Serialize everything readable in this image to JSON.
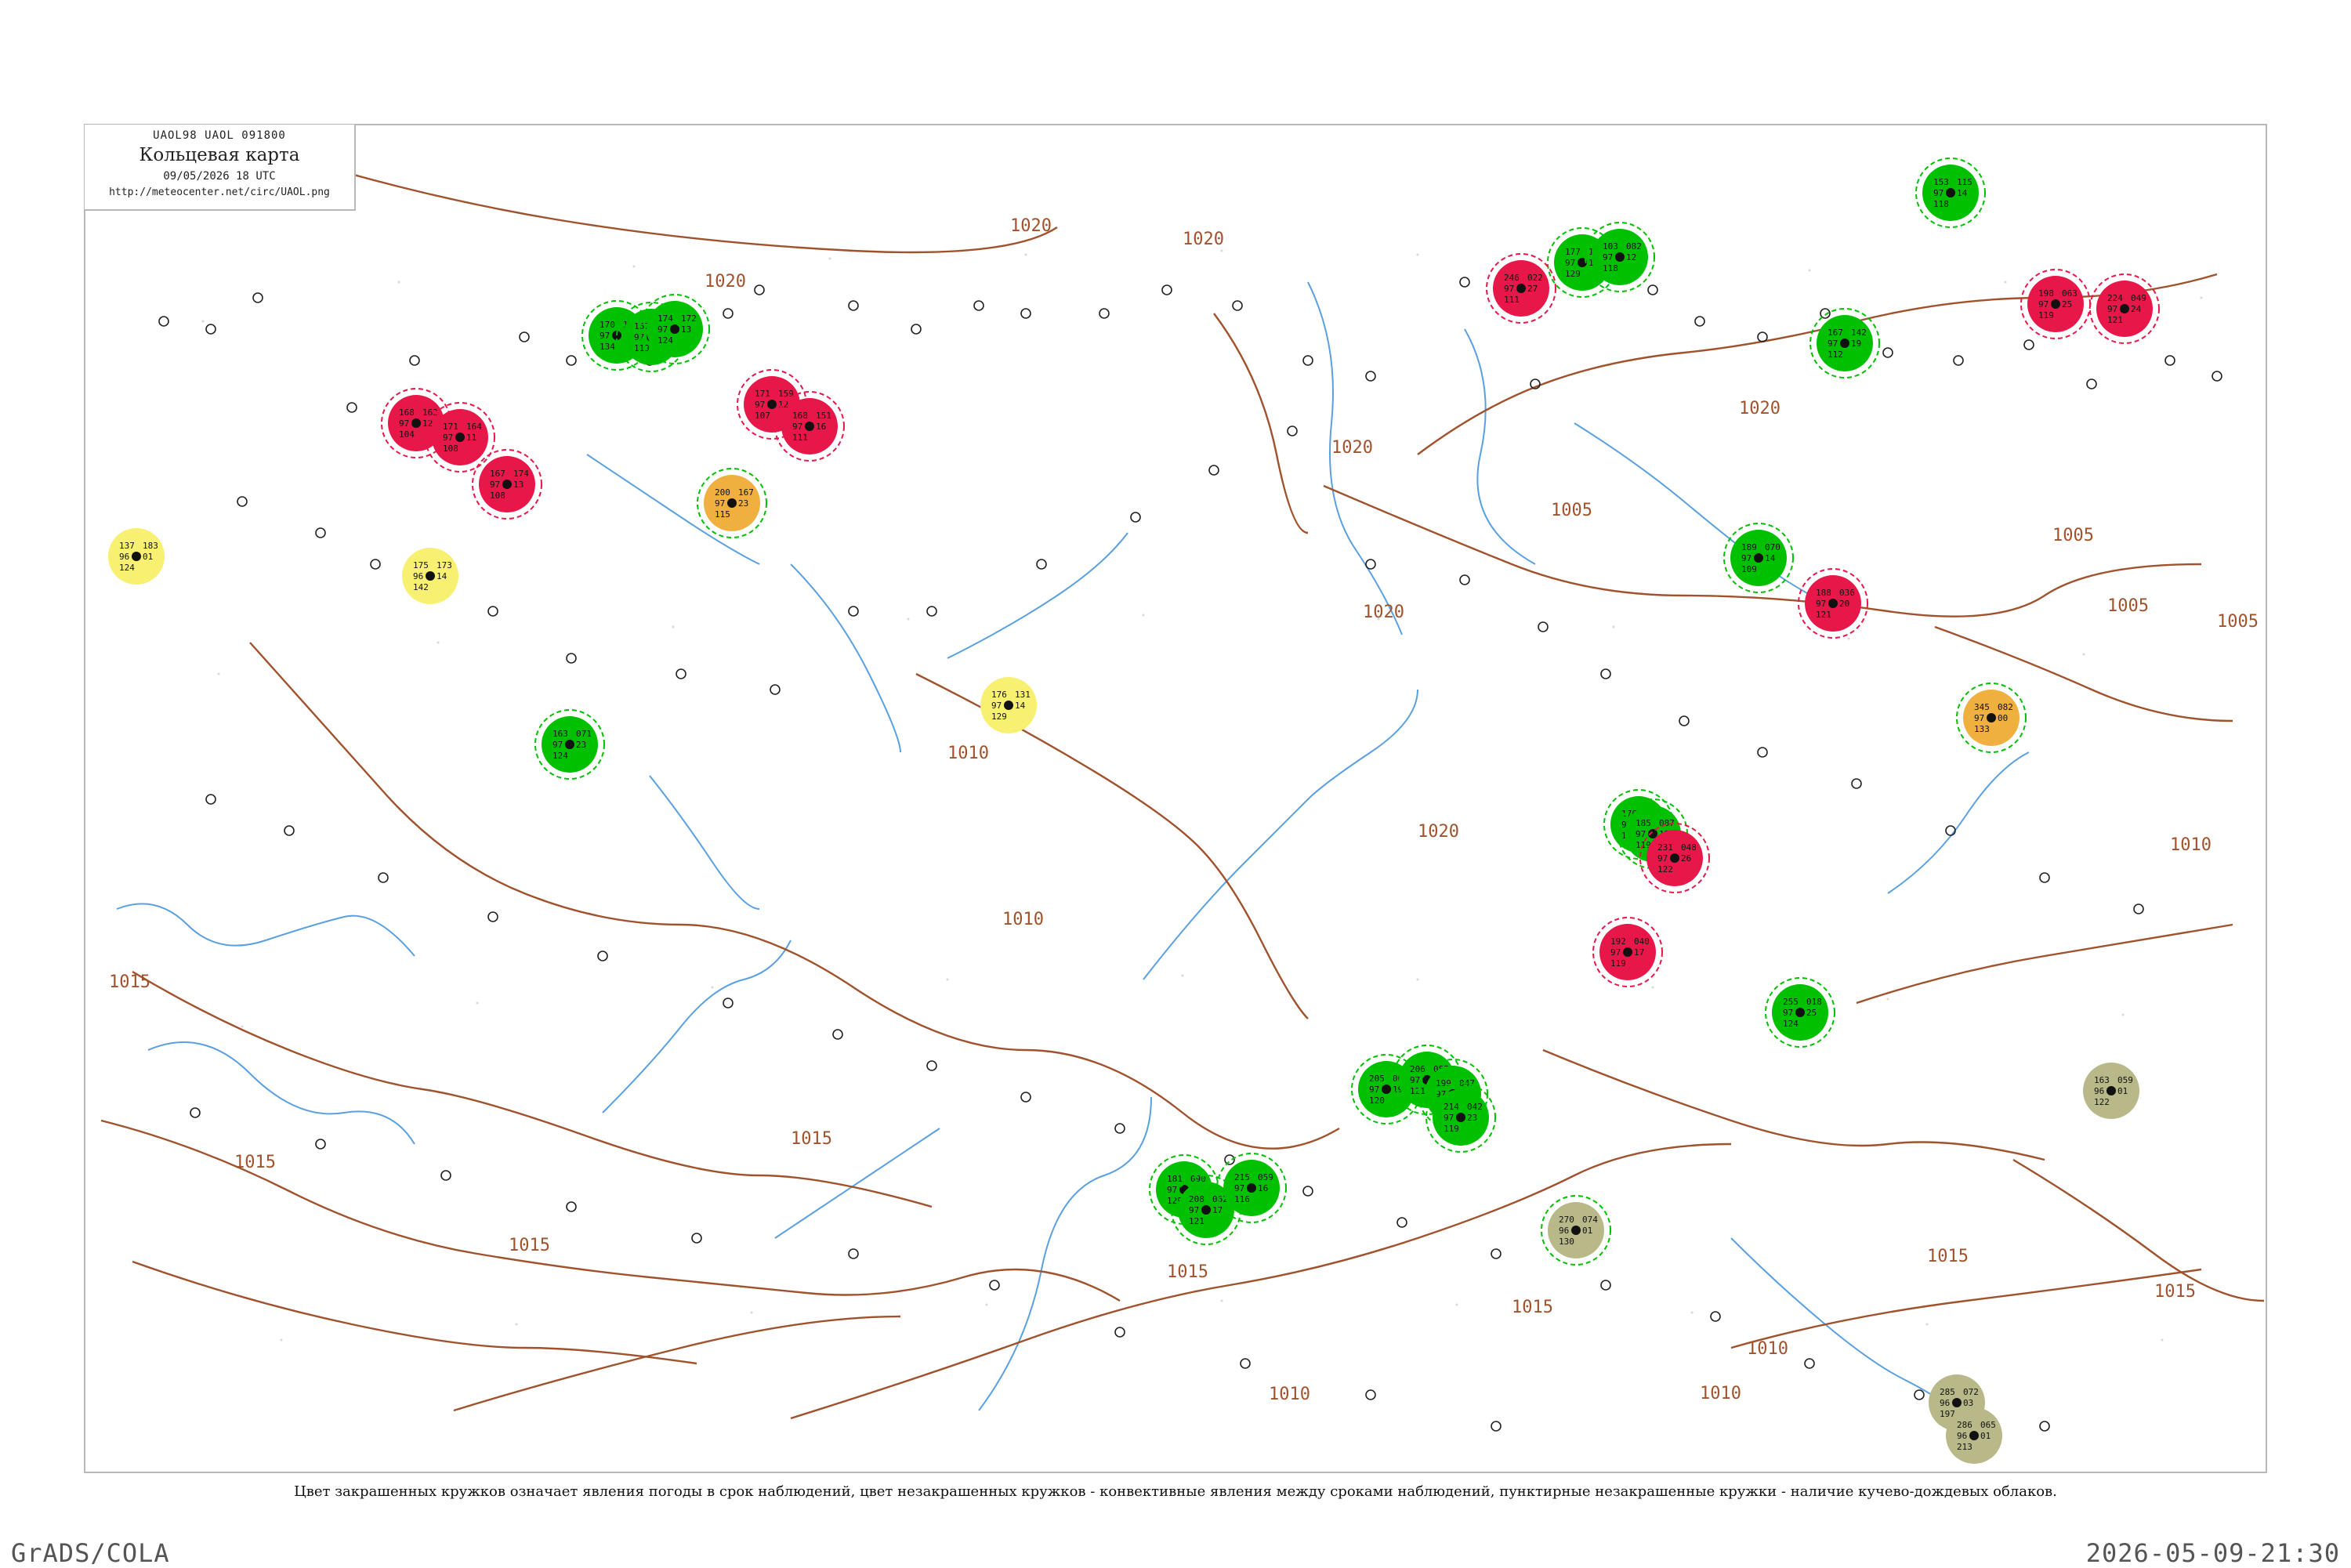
{
  "header": {
    "code_line": "UAOL98  UAOL  091800",
    "title": "Кольцевая карта",
    "datetime": "09/05/2026 18 UTC",
    "url": "http://meteocenter.net/circ/UAOL.png"
  },
  "caption": "Цвет закрашенных кружков означает явления погоды в срок наблюдений, цвет незакрашенных кружков - конвективные явления между сроками наблюдений, пунктирные незакрашенные кружки - наличие кучево-дождевых облаков.",
  "footer": {
    "software": "GrADS/COLA",
    "timestamp": "2026-05-09-21:30"
  },
  "colors": {
    "isobar": "#a0522d",
    "river": "#5aa0e0",
    "frame": "#b8b8b8",
    "marker_green": "#00c000",
    "marker_red": "#e8174a",
    "marker_orange": "#f0b040",
    "marker_yellow": "#f8f070",
    "marker_olive": "#b8b888"
  },
  "map": {
    "isobar_labels": [
      {
        "text": "1020"
      },
      {
        "text": "1020"
      },
      {
        "text": "1020"
      },
      {
        "text": "1020"
      },
      {
        "text": "1020"
      },
      {
        "text": "1020"
      },
      {
        "text": "1020"
      },
      {
        "text": "1020"
      },
      {
        "text": "1015"
      },
      {
        "text": "1015"
      },
      {
        "text": "1015"
      },
      {
        "text": "1015"
      },
      {
        "text": "1015"
      },
      {
        "text": "1015"
      },
      {
        "text": "1015"
      },
      {
        "text": "1015"
      },
      {
        "text": "1010"
      },
      {
        "text": "1010"
      },
      {
        "text": "1010"
      },
      {
        "text": "1010"
      },
      {
        "text": "1010"
      },
      {
        "text": "1010"
      },
      {
        "text": "1005"
      },
      {
        "text": "1005"
      },
      {
        "text": "1005"
      },
      {
        "text": "1005"
      }
    ],
    "stations": [
      {
        "values": [
          "137",
          "96",
          "124",
          "183",
          "01"
        ],
        "marker": "yellow",
        "ring": "none"
      },
      {
        "values": [
          "175",
          "96",
          "142",
          "173",
          "14"
        ],
        "marker": "yellow",
        "ring": "none"
      },
      {
        "values": [
          "200",
          "97",
          "115",
          "167",
          "23"
        ],
        "marker": "orange",
        "ring": "dashed-green"
      },
      {
        "values": [
          "176",
          "97",
          "129",
          "131",
          "14"
        ],
        "marker": "yellow",
        "ring": "none"
      },
      {
        "values": [
          "345",
          "97",
          "133",
          "082",
          "00"
        ],
        "marker": "orange",
        "ring": "dashed-green"
      },
      {
        "values": [
          "163",
          "96",
          "122",
          "059",
          "01"
        ],
        "marker": "olive",
        "ring": "none"
      },
      {
        "values": [
          "270",
          "96",
          "130",
          "074",
          "01"
        ],
        "marker": "olive",
        "ring": "dashed-green"
      },
      {
        "values": [
          "285",
          "96",
          "197",
          "072",
          "03"
        ],
        "marker": "olive",
        "ring": "none"
      },
      {
        "values": [
          "286",
          "96",
          "213",
          "065",
          "01"
        ],
        "marker": "olive",
        "ring": "none"
      },
      {
        "values": [
          "170",
          "97",
          "134",
          "184",
          "12"
        ],
        "marker": "green",
        "ring": "green"
      },
      {
        "values": [
          "167",
          "97",
          "119",
          "180",
          "14"
        ],
        "marker": "green",
        "ring": "green"
      },
      {
        "values": [
          "174",
          "97",
          "124",
          "172",
          "13"
        ],
        "marker": "green",
        "ring": "green"
      },
      {
        "values": [
          "177",
          "97",
          "129",
          "168",
          "16"
        ],
        "marker": "green",
        "ring": "green"
      },
      {
        "values": [
          "103",
          "97",
          "118",
          "082",
          "12"
        ],
        "marker": "green",
        "ring": "green"
      },
      {
        "values": [
          "167",
          "97",
          "112",
          "142",
          "19"
        ],
        "marker": "green",
        "ring": "green"
      },
      {
        "values": [
          "153",
          "97",
          "118",
          "115",
          "14"
        ],
        "marker": "green",
        "ring": "green"
      },
      {
        "values": [
          "189",
          "97",
          "109",
          "070",
          "14"
        ],
        "marker": "green",
        "ring": "green"
      },
      {
        "values": [
          "176",
          "97",
          "118",
          "091",
          "13"
        ],
        "marker": "green",
        "ring": "green"
      },
      {
        "values": [
          "185",
          "97",
          "119",
          "087",
          "17"
        ],
        "marker": "green",
        "ring": "green"
      },
      {
        "values": [
          "205",
          "97",
          "120",
          "064",
          "19"
        ],
        "marker": "green",
        "ring": "green"
      },
      {
        "values": [
          "206",
          "97",
          "121",
          "057",
          "20"
        ],
        "marker": "green",
        "ring": "green"
      },
      {
        "values": [
          "199",
          "97",
          "117",
          "047",
          "24"
        ],
        "marker": "green",
        "ring": "green"
      },
      {
        "values": [
          "214",
          "97",
          "119",
          "042",
          "23"
        ],
        "marker": "green",
        "ring": "green"
      },
      {
        "values": [
          "181",
          "97",
          "129",
          "090",
          "15"
        ],
        "marker": "green",
        "ring": "green"
      },
      {
        "values": [
          "208",
          "97",
          "121",
          "062",
          "17"
        ],
        "marker": "green",
        "ring": "green"
      },
      {
        "values": [
          "215",
          "97",
          "116",
          "059",
          "16"
        ],
        "marker": "green",
        "ring": "green"
      },
      {
        "values": [
          "163",
          "97",
          "124",
          "071",
          "23"
        ],
        "marker": "green",
        "ring": "green"
      },
      {
        "values": [
          "255",
          "97",
          "124",
          "018",
          "25"
        ],
        "marker": "green",
        "ring": "green"
      },
      {
        "values": [
          "168",
          "97",
          "104",
          "162",
          "12"
        ],
        "marker": "red",
        "ring": "red"
      },
      {
        "values": [
          "171",
          "97",
          "108",
          "164",
          "11"
        ],
        "marker": "red",
        "ring": "red"
      },
      {
        "values": [
          "167",
          "97",
          "108",
          "174",
          "13"
        ],
        "marker": "red",
        "ring": "red"
      },
      {
        "values": [
          "171",
          "97",
          "107",
          "159",
          "12"
        ],
        "marker": "red",
        "ring": "red"
      },
      {
        "values": [
          "168",
          "97",
          "111",
          "151",
          "16"
        ],
        "marker": "red",
        "ring": "red"
      },
      {
        "values": [
          "246",
          "97",
          "111",
          "022",
          "27"
        ],
        "marker": "red",
        "ring": "red"
      },
      {
        "values": [
          "198",
          "97",
          "119",
          "063",
          "25"
        ],
        "marker": "red",
        "ring": "red"
      },
      {
        "values": [
          "224",
          "97",
          "121",
          "049",
          "24"
        ],
        "marker": "red",
        "ring": "red"
      },
      {
        "values": [
          "231",
          "97",
          "122",
          "048",
          "26"
        ],
        "marker": "red",
        "ring": "red"
      },
      {
        "values": [
          "192",
          "97",
          "119",
          "040",
          "17"
        ],
        "marker": "red",
        "ring": "red"
      },
      {
        "values": [
          "188",
          "97",
          "121",
          "036",
          "20"
        ],
        "marker": "red",
        "ring": "red"
      }
    ]
  }
}
